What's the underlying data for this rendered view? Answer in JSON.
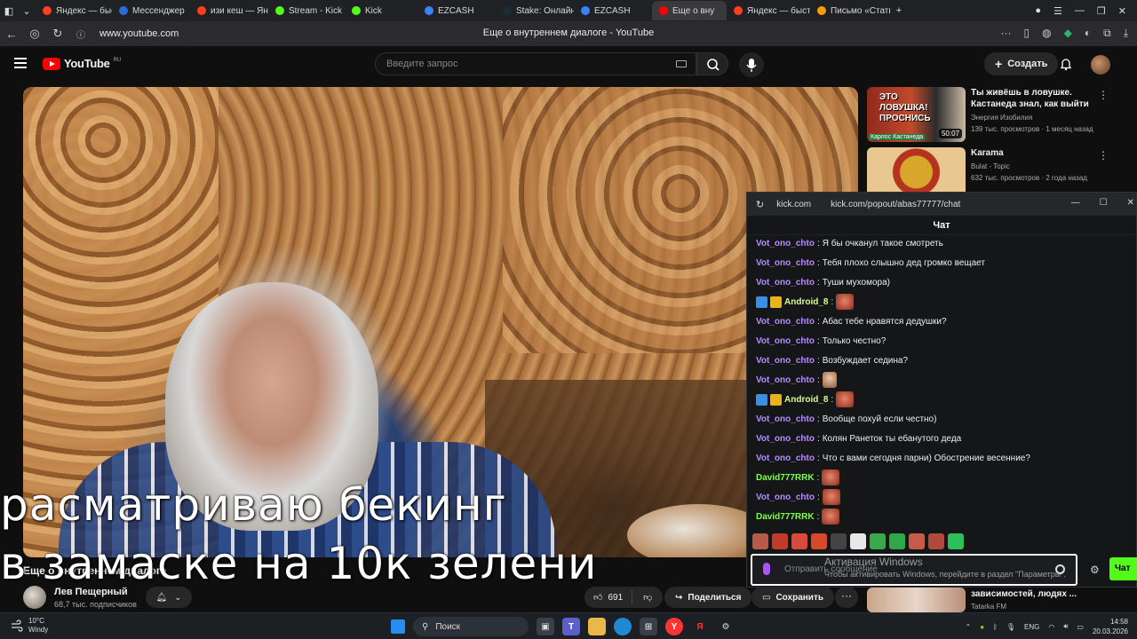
{
  "browser": {
    "tabs": [
      {
        "label": "",
        "color": "#555555",
        "active": false
      },
      {
        "label": "Яндекс — быстр",
        "color": "#fc3f1d",
        "active": false
      },
      {
        "label": "Мессенджер",
        "color": "#2f6bd6",
        "active": false
      },
      {
        "label": "изи кеш — Янде",
        "color": "#fc3f1d",
        "active": false
      },
      {
        "label": "Stream - Kick D",
        "color": "#53fc18",
        "active": false
      },
      {
        "label": "Kick",
        "color": "#53fc18",
        "active": false
      },
      {
        "label": "EZCASH",
        "color": "#3b82f6",
        "active": false
      },
      {
        "label": "Stake: Онлайн",
        "color": "#1a2c38",
        "active": false
      },
      {
        "label": "EZCASH",
        "color": "#3b82f6",
        "active": false
      },
      {
        "label": "Еще о вну",
        "color": "#ff0000",
        "active": true
      },
      {
        "label": "Яндекс — быстр",
        "color": "#fc3f1d",
        "active": false
      },
      {
        "label": "Письмо «Стать",
        "color": "#f59e0b",
        "active": false
      }
    ],
    "url": "www.youtube.com",
    "page_title": "Еще о внутреннем диалоге - YouTube"
  },
  "youtube": {
    "logo": "YouTube",
    "region": "RU",
    "search_placeholder": "Введите запрос",
    "create_label": "Создать",
    "video": {
      "subtitle_line1": "расматриваю бекинг",
      "subtitle_line2": "в замаске  на 10к зелени",
      "title": "Еще о внутреннем диалоге"
    },
    "channel": {
      "name": "Лев Пещерный",
      "subscribers": "68,7 тыс. подписчиков"
    },
    "likes": "691",
    "share_label": "Поделиться",
    "save_label": "Сохранить",
    "more_label": "···",
    "recommendations": [
      {
        "title": "Ты живёшь в ловушке. Кастанеда знал, как выйти",
        "channel": "Энергия Изобилия",
        "meta": "139 тыс. просмотров · 1 месяц назад",
        "duration": "50:07",
        "thumb_text": "ЭТО ЛОВУШКА! ПРОСНИСЬ",
        "thumb_caption": "Карлос Кастанеда"
      },
      {
        "title": "Karama",
        "channel": "Bulat - Topic",
        "meta": "632 тыс. просмотров · 2 года назад",
        "duration": "",
        "thumb_text": "",
        "thumb_caption": ""
      },
      {
        "title": "зависимостей, людях ...",
        "channel": "Tatarka FM",
        "meta": "",
        "duration": "",
        "thumb_text": "",
        "thumb_caption": ""
      }
    ]
  },
  "kick_popup": {
    "domain": "kick.com",
    "path": "kick.com/popout/abas77777/chat",
    "header": "Чат",
    "messages": [
      {
        "user": "Vot_ono_chto",
        "text": "Я бы очканул такое смотреть",
        "color": "#b68cff",
        "badges": false,
        "emote": ""
      },
      {
        "user": "Vot_ono_chto",
        "text": "Тебя плохо слышно дед громко вещает",
        "color": "#b68cff",
        "badges": false,
        "emote": ""
      },
      {
        "user": "Vot_ono_chto",
        "text": "Туши мухомора)",
        "color": "#b68cff",
        "badges": false,
        "emote": ""
      },
      {
        "user": "Android_8",
        "text": "",
        "color": "#d4ff8a",
        "badges": true,
        "emote": "red"
      },
      {
        "user": "Vot_ono_chto",
        "text": "Абас тебе нравятся дедушки?",
        "color": "#b68cff",
        "badges": false,
        "emote": ""
      },
      {
        "user": "Vot_ono_chto",
        "text": "Только честно?",
        "color": "#b68cff",
        "badges": false,
        "emote": ""
      },
      {
        "user": "Vot_ono_chto",
        "text": "Возбуждает седина?",
        "color": "#b68cff",
        "badges": false,
        "emote": ""
      },
      {
        "user": "Vot_ono_chto",
        "text": "",
        "color": "#b68cff",
        "badges": false,
        "emote": "face"
      },
      {
        "user": "Android_8",
        "text": "",
        "color": "#d4ff8a",
        "badges": true,
        "emote": "red"
      },
      {
        "user": "Vot_ono_chto",
        "text": "Вообще похуй если честно)",
        "color": "#b68cff",
        "badges": false,
        "emote": ""
      },
      {
        "user": "Vot_ono_chto",
        "text": "Колян Ранеток ты ебанутого деда",
        "color": "#b68cff",
        "badges": false,
        "emote": ""
      },
      {
        "user": "Vot_ono_chto",
        "text": "Что с вами сегодня парни) Обострение весенние?",
        "color": "#b68cff",
        "badges": false,
        "emote": ""
      },
      {
        "user": "David777RRK",
        "text": "",
        "color": "#7fff4a",
        "badges": false,
        "emote": "red"
      },
      {
        "user": "Vot_ono_chto",
        "text": "",
        "color": "#b68cff",
        "badges": false,
        "emote": "red"
      },
      {
        "user": "David777RRK",
        "text": "",
        "color": "#7fff4a",
        "badges": false,
        "emote": "red"
      }
    ],
    "input_placeholder": "Отправить сообщение",
    "send_label": "Чат"
  },
  "windows_activation": {
    "title": "Активация Windows",
    "text": "Чтобы активировать Windows, перейдите в раздел \"Параметры\"."
  },
  "taskbar": {
    "temperature": "10°C",
    "weather": "Windy",
    "search_label": "Поиск",
    "language": "ENG",
    "time": "14:58",
    "date": "20.03.2026"
  }
}
